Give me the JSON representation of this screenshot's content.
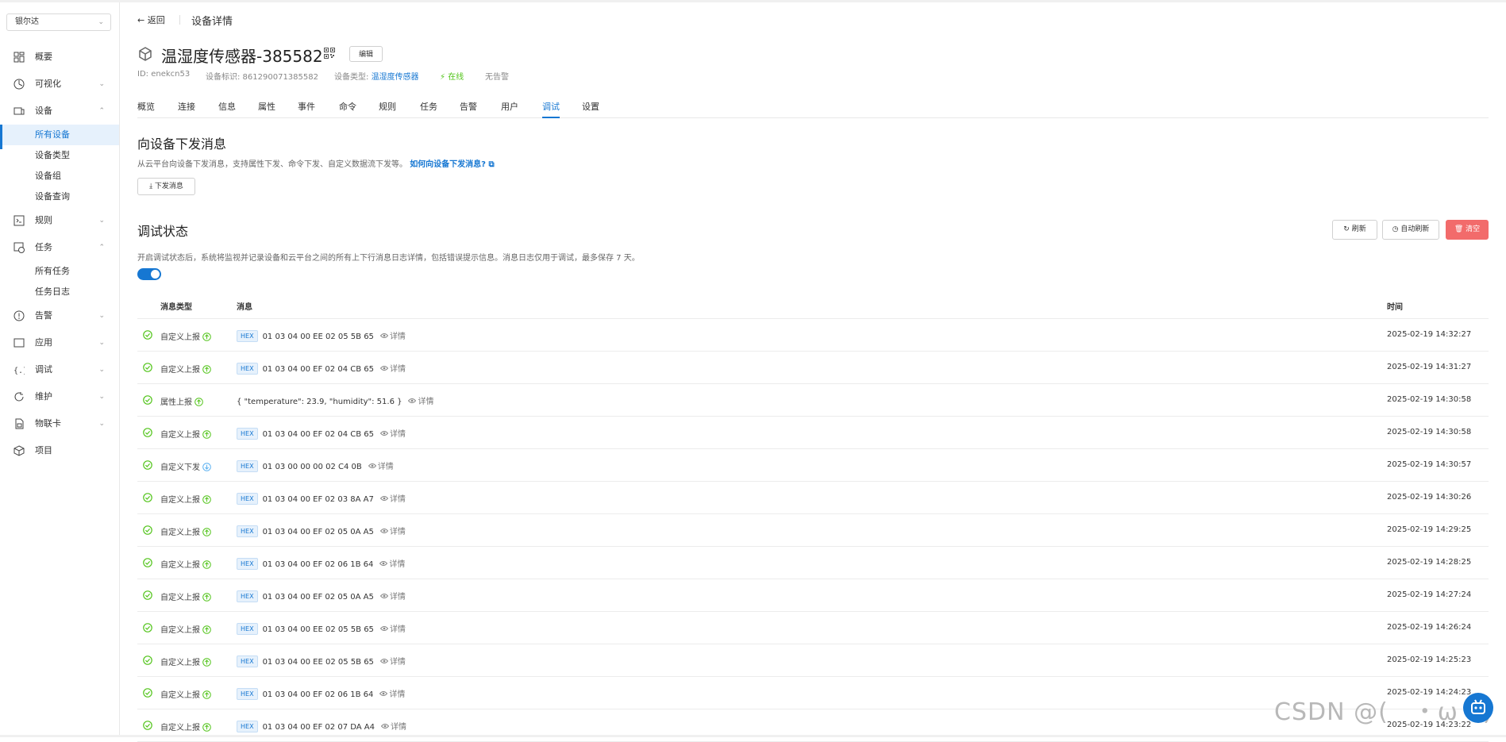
{
  "sidebar": {
    "org": "银尔达",
    "items": [
      {
        "label": "概要",
        "icon": "dashboard-icon",
        "chevron": ""
      },
      {
        "label": "可视化",
        "icon": "visualize-icon",
        "chevron": "⌄"
      },
      {
        "label": "设备",
        "icon": "device-icon",
        "chevron": "⌃"
      },
      {
        "label": "规则",
        "icon": "rule-icon",
        "chevron": "⌄"
      },
      {
        "label": "任务",
        "icon": "task-icon",
        "chevron": "⌃"
      },
      {
        "label": "告警",
        "icon": "alarm-icon",
        "chevron": "⌄"
      },
      {
        "label": "应用",
        "icon": "app-icon",
        "chevron": "⌄"
      },
      {
        "label": "调试",
        "icon": "debug-icon",
        "chevron": "⌄"
      },
      {
        "label": "维护",
        "icon": "maintain-icon",
        "chevron": "⌄"
      },
      {
        "label": "物联卡",
        "icon": "sim-icon",
        "chevron": "⌄"
      },
      {
        "label": "项目",
        "icon": "project-icon",
        "chevron": ""
      }
    ],
    "device_sub": [
      "所有设备",
      "设备类型",
      "设备组",
      "设备查询"
    ],
    "task_sub": [
      "所有任务",
      "任务日志"
    ]
  },
  "header": {
    "back": "← 返回",
    "title": "设备详情",
    "device_name": "温湿度传感器-385582",
    "edit": "编辑",
    "id": "ID: enekcn53",
    "identifier": "设备标识: 861290071385582",
    "type_label": "设备类型:",
    "type_value": "温湿度传感器",
    "online": "在线",
    "alarm": "无告警"
  },
  "tabs": [
    "概览",
    "连接",
    "信息",
    "属性",
    "事件",
    "命令",
    "规则",
    "任务",
    "告警",
    "用户",
    "调试",
    "设置"
  ],
  "send_section": {
    "title": "向设备下发消息",
    "desc": "从云平台向设备下发消息，支持属性下发、命令下发、自定义数据流下发等。",
    "link": "如何向设备下发消息?",
    "button": "下发消息"
  },
  "debug_section": {
    "title": "调试状态",
    "desc": "开启调试状态后，系统将监视并记录设备和云平台之间的所有上下行消息日志详情，包括错误提示信息。消息日志仅用于调试，最多保存 7 天。",
    "refresh": "刷新",
    "auto_refresh": "自动刷新",
    "clear": "清空",
    "enabled": true
  },
  "table": {
    "headers": {
      "type": "消息类型",
      "msg": "消息",
      "time": "时间"
    },
    "detail": "详情",
    "hex": "HEX",
    "rows": [
      {
        "type": "自定义上报",
        "dir": "up",
        "hex": true,
        "msg": "01 03 04 00 EE 02 05 5B 65",
        "time": "2025-02-19 14:32:27"
      },
      {
        "type": "自定义上报",
        "dir": "up",
        "hex": true,
        "msg": "01 03 04 00 EF 02 04 CB 65",
        "time": "2025-02-19 14:31:27"
      },
      {
        "type": "属性上报",
        "dir": "up",
        "hex": false,
        "msg": "{ \"temperature\": 23.9, \"humidity\": 51.6 }",
        "time": "2025-02-19 14:30:58"
      },
      {
        "type": "自定义上报",
        "dir": "up",
        "hex": true,
        "msg": "01 03 04 00 EF 02 04 CB 65",
        "time": "2025-02-19 14:30:58"
      },
      {
        "type": "自定义下发",
        "dir": "down",
        "hex": true,
        "msg": "01 03 00 00 00 02 C4 0B",
        "time": "2025-02-19 14:30:57"
      },
      {
        "type": "自定义上报",
        "dir": "up",
        "hex": true,
        "msg": "01 03 04 00 EF 02 03 8A A7",
        "time": "2025-02-19 14:30:26"
      },
      {
        "type": "自定义上报",
        "dir": "up",
        "hex": true,
        "msg": "01 03 04 00 EF 02 05 0A A5",
        "time": "2025-02-19 14:29:25"
      },
      {
        "type": "自定义上报",
        "dir": "up",
        "hex": true,
        "msg": "01 03 04 00 EF 02 06 1B 64",
        "time": "2025-02-19 14:28:25"
      },
      {
        "type": "自定义上报",
        "dir": "up",
        "hex": true,
        "msg": "01 03 04 00 EF 02 05 0A A5",
        "time": "2025-02-19 14:27:24"
      },
      {
        "type": "自定义上报",
        "dir": "up",
        "hex": true,
        "msg": "01 03 04 00 EE 02 05 5B 65",
        "time": "2025-02-19 14:26:24"
      },
      {
        "type": "自定义上报",
        "dir": "up",
        "hex": true,
        "msg": "01 03 04 00 EE 02 05 5B 65",
        "time": "2025-02-19 14:25:23"
      },
      {
        "type": "自定义上报",
        "dir": "up",
        "hex": true,
        "msg": "01 03 04 00 EF 02 06 1B 64",
        "time": "2025-02-19 14:24:23"
      },
      {
        "type": "自定义上报",
        "dir": "up",
        "hex": true,
        "msg": "01 03 04 00 EF 02 07 DA A4",
        "time": "2025-02-19 14:23:22"
      }
    ]
  },
  "watermark": "CSDN @(　・ω・)",
  "colors": {
    "accent": "#1677d2",
    "success": "#52c41a",
    "danger": "#f26b6b"
  }
}
